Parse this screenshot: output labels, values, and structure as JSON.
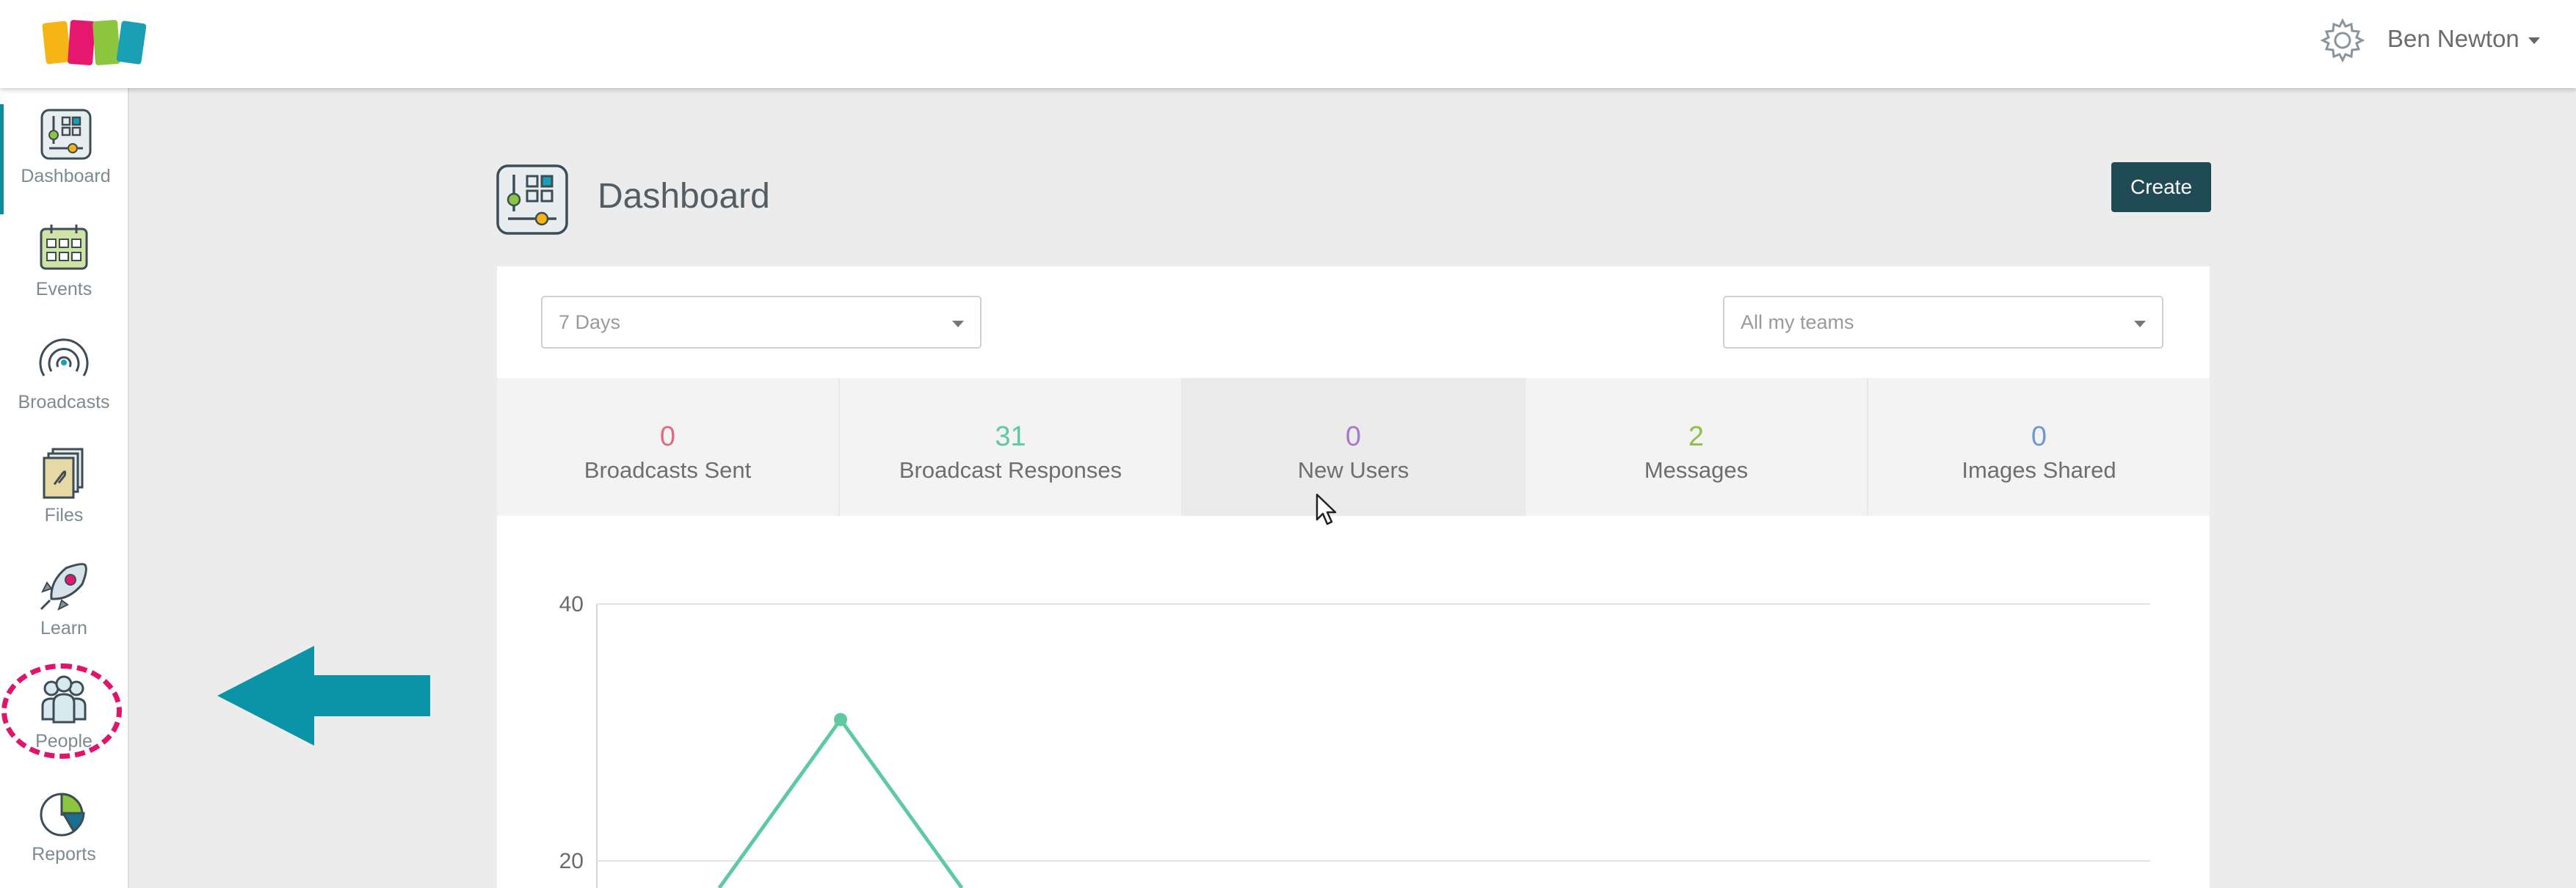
{
  "header": {
    "user_name": "Ben Newton"
  },
  "sidebar": {
    "items": [
      {
        "label": "Dashboard",
        "icon": "dashboard-icon"
      },
      {
        "label": "Events",
        "icon": "calendar-icon"
      },
      {
        "label": "Broadcasts",
        "icon": "broadcast-icon"
      },
      {
        "label": "Files",
        "icon": "files-icon"
      },
      {
        "label": "Learn",
        "icon": "rocket-icon"
      },
      {
        "label": "People",
        "icon": "people-icon"
      },
      {
        "label": "Reports",
        "icon": "pie-chart-icon"
      }
    ]
  },
  "page": {
    "title": "Dashboard",
    "create_label": "Create"
  },
  "filters": {
    "range": "7 Days",
    "teams": "All my teams"
  },
  "stats": [
    {
      "value": "0",
      "label": "Broadcasts Sent",
      "color": "#e06a7e"
    },
    {
      "value": "31",
      "label": "Broadcast Responses",
      "color": "#5ec9a3"
    },
    {
      "value": "0",
      "label": "New Users",
      "color": "#a57bc9"
    },
    {
      "value": "2",
      "label": "Messages",
      "color": "#8cbf4d"
    },
    {
      "value": "0",
      "label": "Images Shared",
      "color": "#6f97d4"
    }
  ],
  "chart_data": {
    "type": "line",
    "y_ticks": [
      40,
      20
    ],
    "ylim": [
      0,
      40
    ],
    "series": [
      {
        "color": "#5ec9a3",
        "visible_points": [
          {
            "x": 1,
            "y": 31
          }
        ]
      }
    ],
    "grid": true
  },
  "colors": {
    "accent": "#0f8e9a",
    "create_button": "#1f4a56",
    "highlight": "#e1146b"
  }
}
